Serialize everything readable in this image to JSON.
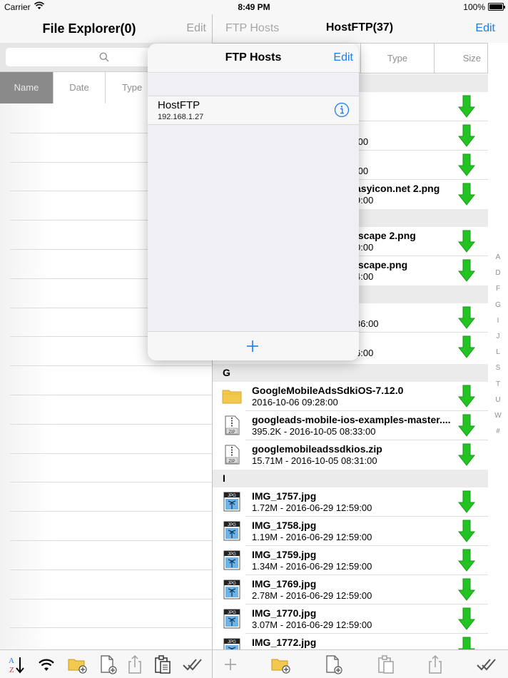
{
  "status_bar": {
    "carrier": "Carrier",
    "time": "8:49 PM",
    "battery": "100%"
  },
  "left": {
    "title": "File Explorer(0)",
    "edit_label": "Edit",
    "sort_tabs": [
      "Name",
      "Date",
      "Type"
    ]
  },
  "right": {
    "back_label": "FTP Hosts",
    "title": "HostFTP(37)",
    "edit_label": "Edit",
    "sort_tabs": [
      "Type",
      "Size"
    ],
    "sections": {
      "G": "G",
      "I": "I"
    },
    "partial_rows": [
      {
        "name": "",
        "meta": ":00"
      },
      {
        "name": "",
        "meta": ":00"
      },
      {
        "name": "asyicon.net 2.png",
        "meta": "9:00"
      },
      {
        "name": "lscape 2.png",
        "meta": "0:00"
      },
      {
        "name": "lscape.png",
        "meta": "4:00"
      },
      {
        "name": "",
        "meta": "36:00"
      },
      {
        "name": "",
        "meta": "6:00"
      }
    ],
    "files_g": [
      {
        "name": "GoogleMobileAdsSdkiOS-7.12.0",
        "meta": "2016-10-06 09:28:00",
        "kind": "folder"
      },
      {
        "name": "googleads-mobile-ios-examples-master....",
        "meta": "395.2K - 2016-10-05 08:33:00",
        "kind": "zip"
      },
      {
        "name": "googlemobileadssdkios.zip",
        "meta": "15.71M - 2016-10-05 08:31:00",
        "kind": "zip"
      }
    ],
    "files_i": [
      {
        "name": "IMG_1757.jpg",
        "meta": "1.72M - 2016-06-29 12:59:00",
        "kind": "jpg"
      },
      {
        "name": "IMG_1758.jpg",
        "meta": "1.19M - 2016-06-29 12:59:00",
        "kind": "jpg"
      },
      {
        "name": "IMG_1759.jpg",
        "meta": "1.34M - 2016-06-29 12:59:00",
        "kind": "jpg"
      },
      {
        "name": "IMG_1769.jpg",
        "meta": "2.78M - 2016-06-29 12:59:00",
        "kind": "jpg"
      },
      {
        "name": "IMG_1770.jpg",
        "meta": "3.07M - 2016-06-29 12:59:00",
        "kind": "jpg"
      },
      {
        "name": "IMG_1772.jpg",
        "meta": "",
        "kind": "jpg"
      }
    ],
    "index_letters": [
      "A",
      "D",
      "F",
      "G",
      "I",
      "J",
      "L",
      "S",
      "T",
      "U",
      "W",
      "#"
    ]
  },
  "popover": {
    "title": "FTP Hosts",
    "edit_label": "Edit",
    "host": {
      "name": "HostFTP",
      "ip": "192.168.1.27"
    }
  },
  "icons": {
    "accent": "#1a7cf6",
    "download_arrow": "#22c322",
    "folder": "#f2c94c"
  }
}
